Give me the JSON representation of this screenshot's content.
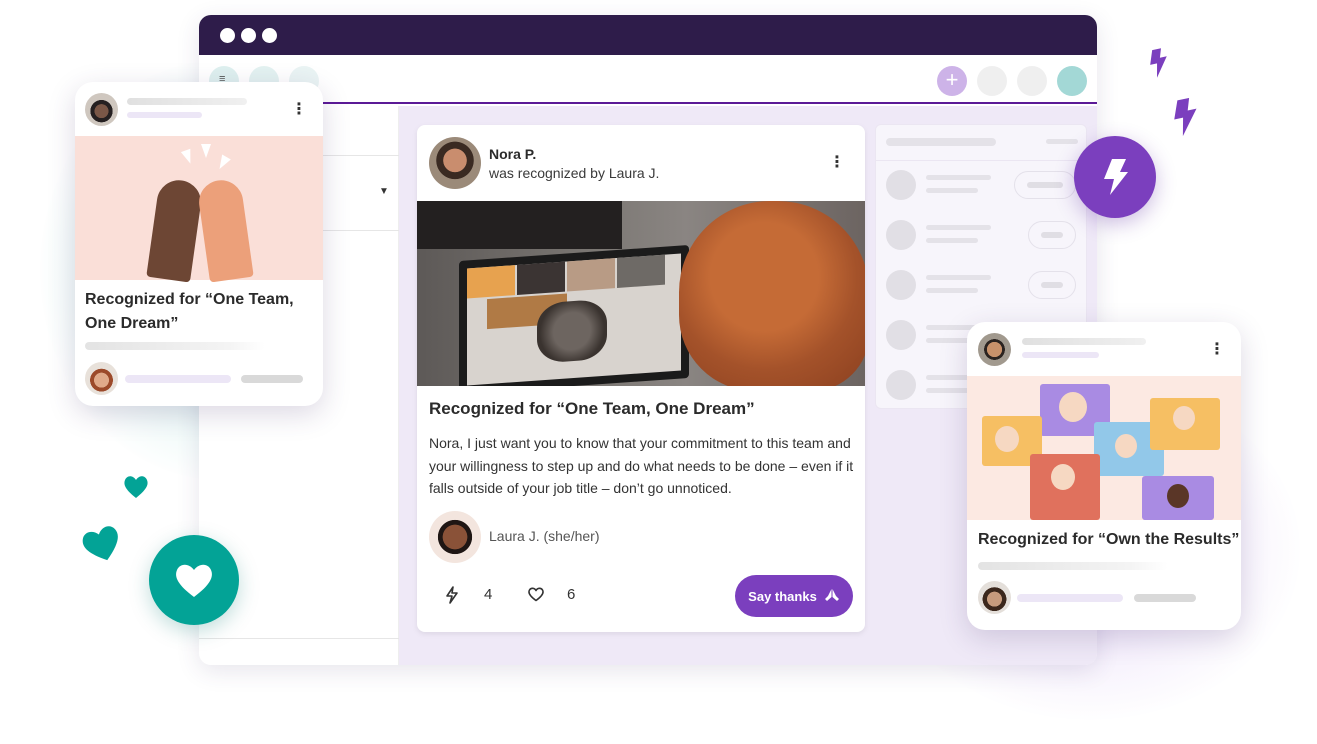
{
  "colors": {
    "titlebar": "#2e1c4a",
    "accent_purple": "#7b3fbe",
    "accent_teal": "#03a396",
    "main_bg": "#efe9f7"
  },
  "browser": {
    "window_dots": 3,
    "toolbar": {
      "add_button_label": "+",
      "menu_icon": "menu-icon"
    }
  },
  "main_post": {
    "recipient_name": "Nora P.",
    "recognized_by": "was recognized by Laura J.",
    "title": "Recognized for “One Team, One Dream”",
    "body": "Nora, I just want you to know that your commitment to this team and your willingness to step up and do what needs to be done – even if it falls outside of your job title – don’t go unnoticed.",
    "sender": "Laura J. (she/her)",
    "reactions": [
      {
        "icon": "lightning-icon",
        "count": "4"
      },
      {
        "icon": "heart-outline-icon",
        "count": "6"
      }
    ],
    "say_thanks_label": "Say thanks",
    "more_icon": "⋮"
  },
  "left_card": {
    "title": "Recognized for “One Team, One Dream”",
    "more_icon": "⋮"
  },
  "right_card": {
    "title": "Recognized for “Own the Results”",
    "more_icon": "⋮"
  },
  "decor": {
    "bolt_badge_icon": "lightning-icon",
    "heart_badge_icon": "heart-icon"
  }
}
